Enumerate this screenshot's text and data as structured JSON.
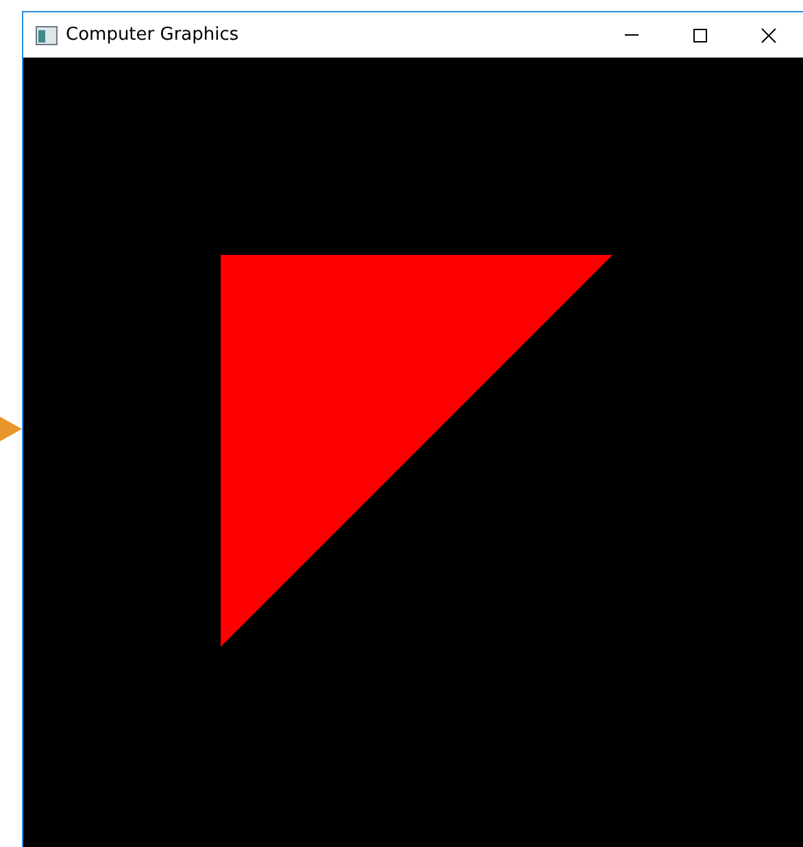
{
  "window": {
    "title": "Computer Graphics"
  }
}
